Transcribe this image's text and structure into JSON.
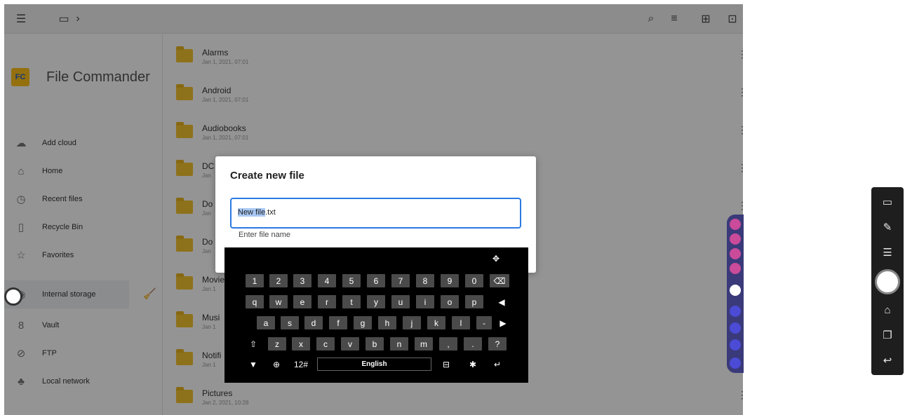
{
  "topbar": {
    "menu_icon": "hamburger-icon",
    "device_icon": "monitor-icon",
    "breadcrumb_chevron": "›",
    "actions": [
      {
        "icon": "search-icon",
        "glyph": "⌕"
      },
      {
        "icon": "sort-icon",
        "glyph": "≡"
      },
      {
        "icon": "new-file-icon",
        "glyph": "⊞"
      },
      {
        "icon": "new-folder-icon",
        "glyph": "⊡"
      }
    ]
  },
  "brand": {
    "logo_text": "FC",
    "name": "File Commander"
  },
  "sidebar": {
    "items": [
      {
        "label": "Add cloud",
        "icon": "cloud-plus-icon",
        "glyph": "☁"
      },
      {
        "label": "Home",
        "icon": "home-icon",
        "glyph": "⌂"
      },
      {
        "label": "Recent files",
        "icon": "clock-icon",
        "glyph": "◷"
      },
      {
        "label": "Recycle Bin",
        "icon": "trash-icon",
        "glyph": "▯"
      },
      {
        "label": "Favorites",
        "icon": "star-icon",
        "glyph": "☆"
      },
      {
        "label": "Internal storage",
        "icon": "storage-icon",
        "glyph": "◉",
        "active": true
      },
      {
        "label": "Vault",
        "icon": "vault-icon",
        "glyph": "8"
      },
      {
        "label": "FTP",
        "icon": "globe-icon",
        "glyph": "⊘"
      },
      {
        "label": "Local network",
        "icon": "network-icon",
        "glyph": "♣"
      }
    ],
    "clean_icon": "broom-icon"
  },
  "files": [
    {
      "name": "Alarms",
      "date": "Jan 1, 2021, 07:01"
    },
    {
      "name": "Android",
      "date": "Jan 1, 2021, 07:01"
    },
    {
      "name": "Audiobooks",
      "date": "Jan 1, 2021, 07:01"
    },
    {
      "name": "DC",
      "date": "Jan"
    },
    {
      "name": "Do",
      "date": "Jan"
    },
    {
      "name": "Do",
      "date": "Jan"
    },
    {
      "name": "Movie",
      "date": "Jan 1"
    },
    {
      "name": "Musi",
      "date": "Jan 1"
    },
    {
      "name": "Notifi",
      "date": "Jan 1"
    },
    {
      "name": "Pictures",
      "date": "Jan 2, 2021, 10:28"
    }
  ],
  "dialog": {
    "title": "Create new file",
    "input_selected": "New file",
    "input_rest": ".txt",
    "hint": "Enter file name"
  },
  "keyboard": {
    "row1": [
      "1",
      "2",
      "3",
      "4",
      "5",
      "6",
      "7",
      "8",
      "9",
      "0"
    ],
    "row2": [
      "q",
      "w",
      "e",
      "r",
      "t",
      "y",
      "u",
      "i",
      "o",
      "p"
    ],
    "row3": [
      "a",
      "s",
      "d",
      "f",
      "g",
      "h",
      "j",
      "k",
      "l",
      "-"
    ],
    "row4": [
      "z",
      "x",
      "c",
      "v",
      "b",
      "n",
      "m",
      ",",
      ".",
      "?"
    ],
    "shift": "⇧",
    "backspace": "⌫",
    "left": "◀",
    "right": "▶",
    "hide": "▼",
    "globe": "⊕",
    "symbols": "12#",
    "language": "English",
    "expand": "⊟",
    "settings": "✱",
    "enter": "↵",
    "move": "✥"
  },
  "sidepanel": {
    "icons": [
      {
        "icon": "screen-share-icon",
        "glyph": "▭"
      },
      {
        "icon": "annotate-icon",
        "glyph": "✎"
      },
      {
        "icon": "comment-icon",
        "glyph": "☰"
      },
      {
        "icon": "home-icon",
        "glyph": "⌂"
      },
      {
        "icon": "windows-icon",
        "glyph": "❐"
      },
      {
        "icon": "back-icon",
        "glyph": "↩"
      }
    ]
  }
}
